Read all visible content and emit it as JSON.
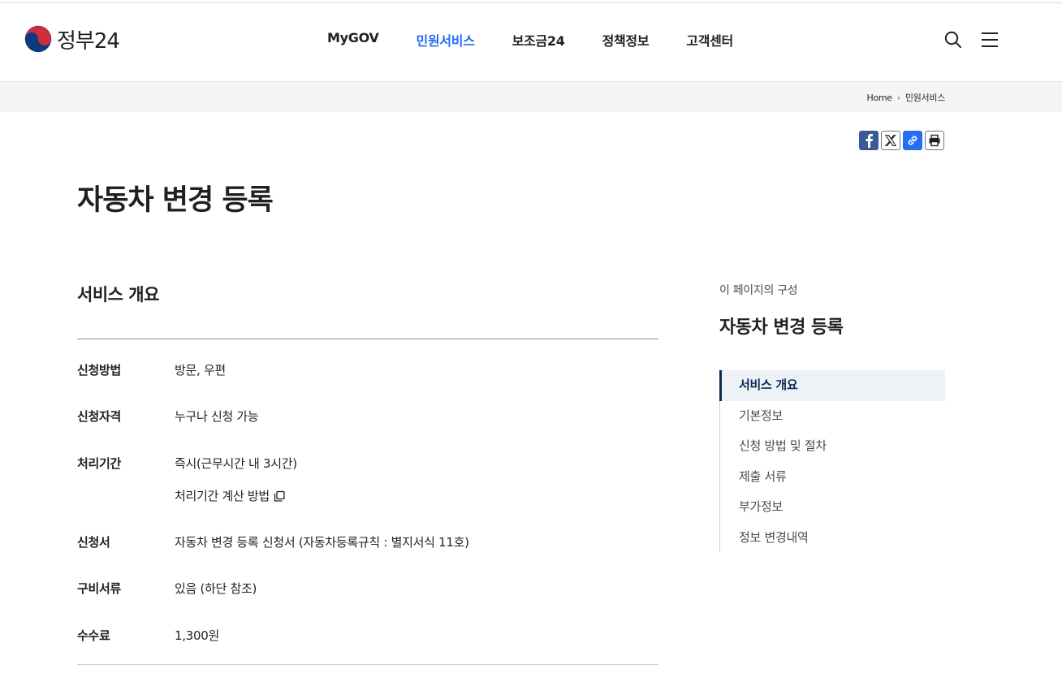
{
  "header": {
    "logo_text": "정부24",
    "nav": [
      {
        "label": "MyGOV",
        "active": false
      },
      {
        "label": "민원서비스",
        "active": true
      },
      {
        "label": "보조금24",
        "active": false
      },
      {
        "label": "정책정보",
        "active": false
      },
      {
        "label": "고객센터",
        "active": false
      }
    ],
    "icons": [
      "search-icon",
      "menu-icon"
    ]
  },
  "breadcrumb": {
    "home": "Home",
    "current": "민원서비스"
  },
  "share": {
    "icons": [
      "facebook-icon",
      "x-icon",
      "link-icon",
      "print-icon"
    ]
  },
  "page_title": "자동차 변경 등록",
  "section": {
    "title": "서비스 개요",
    "rows": [
      {
        "label": "신청방법",
        "value": "방문, 우편"
      },
      {
        "label": "신청자격",
        "value": "누구나 신청 가능"
      },
      {
        "label": "처리기간",
        "value": "즉시(근무시간 내 3시간)",
        "link": "처리기간 계산 방법"
      },
      {
        "label": "신청서",
        "value": "자동차 변경 등록 신청서 (자동차등록규칙 : 별지서식 11호)"
      },
      {
        "label": "구비서류",
        "value": "있음 (하단 참조)"
      },
      {
        "label": "수수료",
        "value": "1,300원"
      }
    ]
  },
  "side": {
    "caption": "이 페이지의 구성",
    "title": "자동차 변경 등록",
    "items": [
      {
        "label": "서비스 개요",
        "active": true
      },
      {
        "label": "기본정보",
        "active": false
      },
      {
        "label": "신청 방법 및 절차",
        "active": false
      },
      {
        "label": "제출 서류",
        "active": false
      },
      {
        "label": "부가정보",
        "active": false
      },
      {
        "label": "정보 변경내역",
        "active": false
      }
    ]
  },
  "colors": {
    "accent": "#256ef4",
    "side_active": "#052b57",
    "crumb_bg": "#f4f5f6"
  }
}
